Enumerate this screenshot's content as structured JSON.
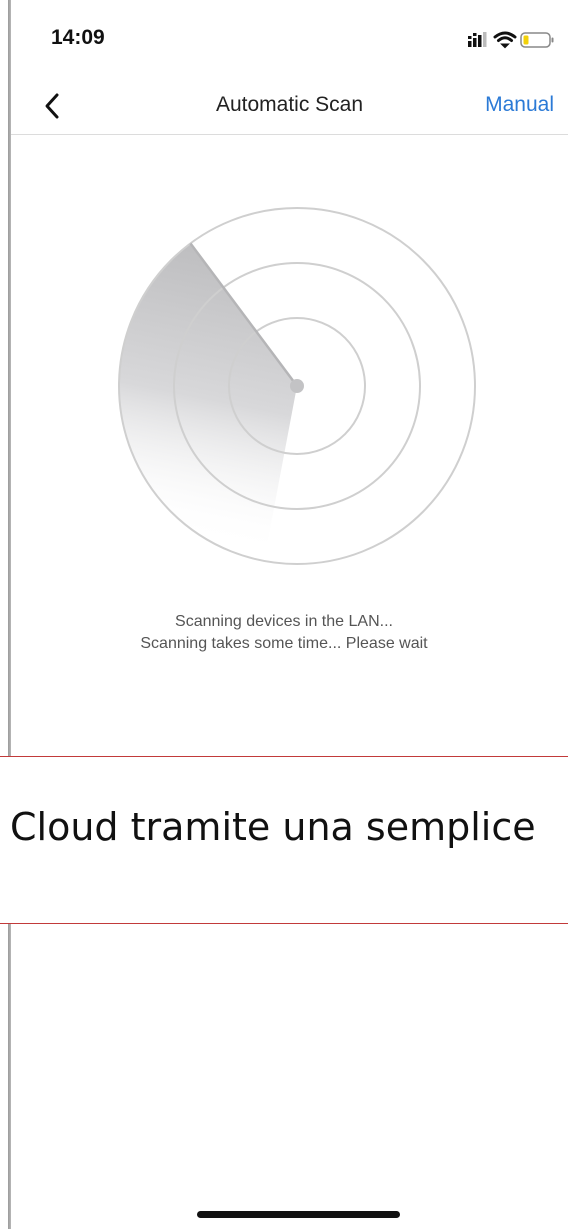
{
  "status_bar": {
    "time": "14:09",
    "icons": [
      "cellular-signal-icon",
      "wifi-icon",
      "battery-icon"
    ]
  },
  "nav": {
    "back_icon": "chevron-left-icon",
    "title": "Automatic Scan",
    "manual_label": "Manual",
    "accent_color": "#2b7ad6"
  },
  "scan": {
    "line1": "Scanning devices in the LAN...",
    "line2": "Scanning takes some time... Please wait"
  },
  "caption": {
    "text": "Cloud tramite una semplice"
  }
}
